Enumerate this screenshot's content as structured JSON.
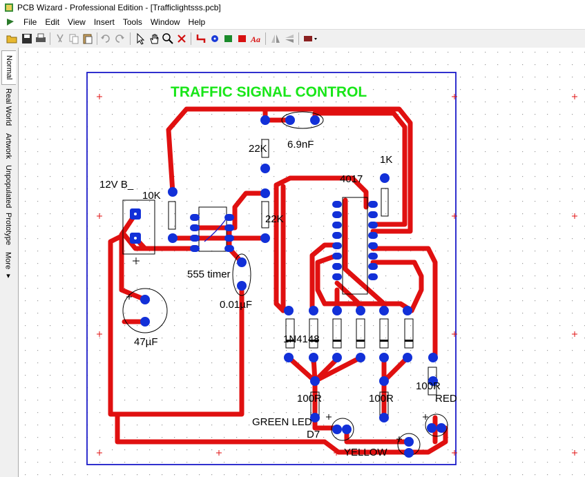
{
  "window": {
    "title": "PCB Wizard - Professional Edition - [Trafficlightsss.pcb]"
  },
  "menu": {
    "items": [
      "File",
      "Edit",
      "View",
      "Insert",
      "Tools",
      "Window",
      "Help"
    ]
  },
  "sidebar": {
    "tabs": [
      "Normal",
      "Real World",
      "Artwork",
      "Unpopulated",
      "Prototype",
      "More ▾"
    ]
  },
  "pcb": {
    "title": "TRAFFIC  SIGNAL  CONTROL",
    "labels": {
      "cap_69nf": "6.9nF",
      "res_22k_top": "22K",
      "res_1k": "1K",
      "ic_4017": "4017",
      "supply": "12V B_",
      "res_10k": "10K",
      "res_22k_mid": "22K",
      "ic_555": "555 timer",
      "cap_001uf": "0.01µF",
      "cap_47uf": "47µF",
      "diode": "1N4148",
      "res_100r_left": "100R",
      "res_100r_mid": "100R",
      "res_100r_right": "100R",
      "led_red": "RED",
      "led_green": "GREEN LED",
      "led_d7": "D7",
      "led_yellow": "YELLOW"
    },
    "colors": {
      "track": "#e01010",
      "pad": "#1230d8",
      "title": "#19e619",
      "border": "#1a1ac8",
      "grid": "#9a9a9a",
      "origin": "#e01010"
    }
  }
}
